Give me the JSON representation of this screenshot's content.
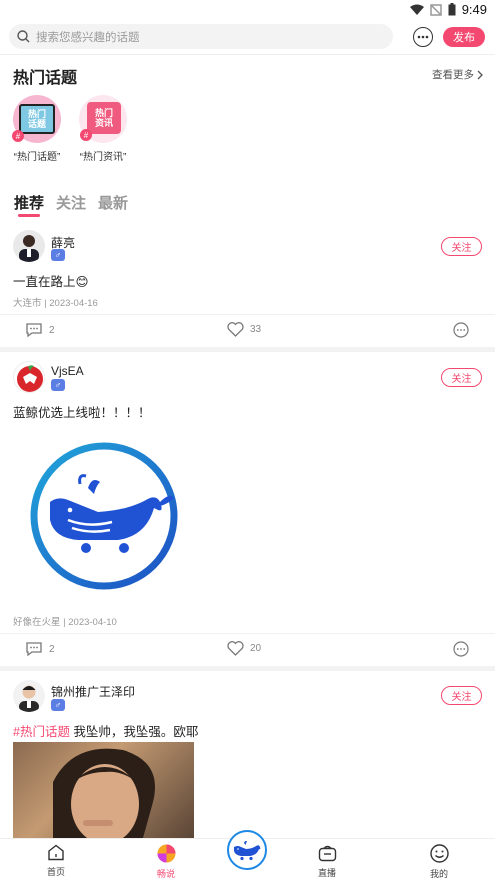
{
  "status_bar": {
    "time": "9:49"
  },
  "search": {
    "placeholder": "搜索您感兴趣的话题"
  },
  "header": {
    "publish_label": "发布"
  },
  "hot_topics": {
    "title": "热门话题",
    "see_more": "查看更多",
    "items": [
      {
        "label": "“热门话题”",
        "badge_text": "热门话题"
      },
      {
        "label": "“热门资讯”",
        "badge_text": "热门资讯"
      }
    ]
  },
  "tabs": [
    {
      "label": "推荐"
    },
    {
      "label": "关注"
    },
    {
      "label": "最新"
    }
  ],
  "posts": [
    {
      "username": "薛亮",
      "gender": "♂",
      "follow_label": "关注",
      "text": "一直在路上😊",
      "meta": "大连市 | 2023-04-16",
      "comments": "2",
      "likes": "33"
    },
    {
      "username": "VjsEA",
      "gender": "♂",
      "follow_label": "关注",
      "text": "蓝鲸优选上线啦！！！！",
      "meta": "好像在火星 | 2023-04-10",
      "comments": "2",
      "likes": "20"
    },
    {
      "username": "锦州推广王泽印",
      "gender": "♂",
      "follow_label": "关注",
      "hashtag": "#热门话题",
      "text": " 我坠帅，我坠强。欧耶"
    }
  ],
  "bottom_nav": [
    {
      "label": "首页"
    },
    {
      "label": "畅说"
    },
    {
      "label": "直播"
    },
    {
      "label": "我的"
    }
  ],
  "colors": {
    "accent": "#f3486f",
    "brand_blue": "#1e88e5",
    "gender_blue": "#5b7ee5"
  }
}
